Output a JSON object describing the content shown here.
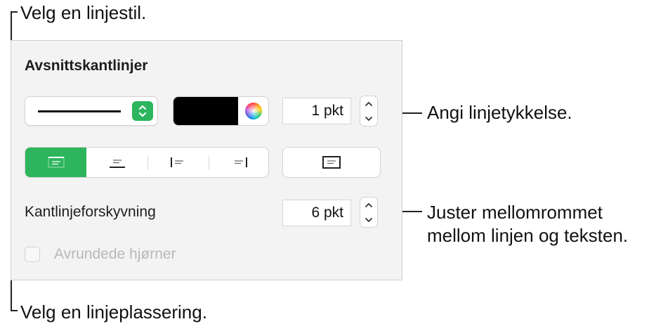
{
  "callouts": {
    "line_style": "Velg en linjestil.",
    "thickness": "Angi linjetykkelse.",
    "offset_line1": "Juster mellomrommet",
    "offset_line2": "mellom linjen og teksten.",
    "placement": "Velg en linjeplassering."
  },
  "panel": {
    "title": "Avsnittskantlinjer",
    "line_style_popup": {
      "selected": "solid line",
      "icon": "up-down-arrows-icon"
    },
    "color_well": {
      "color": "#000000",
      "picker_icon": "color-wheel-icon"
    },
    "thickness_field": {
      "value": "1 pkt"
    },
    "placement_segments": [
      {
        "name": "border-top",
        "icon": "border-top-icon",
        "selected": true
      },
      {
        "name": "border-bottom",
        "icon": "border-bottom-icon",
        "selected": false
      },
      {
        "name": "border-left",
        "icon": "border-left-icon",
        "selected": false
      },
      {
        "name": "border-right",
        "icon": "border-right-icon",
        "selected": false
      }
    ],
    "box_button": {
      "icon": "border-box-icon"
    },
    "offset_label": "Kantlinjeforskyvning",
    "offset_field": {
      "value": "6 pkt"
    },
    "rounded_corners": {
      "label": "Avrundede hjørner",
      "checked": false,
      "enabled": false
    }
  },
  "colors": {
    "accent": "#2db55d",
    "panel_bg": "#f3f3f3"
  }
}
